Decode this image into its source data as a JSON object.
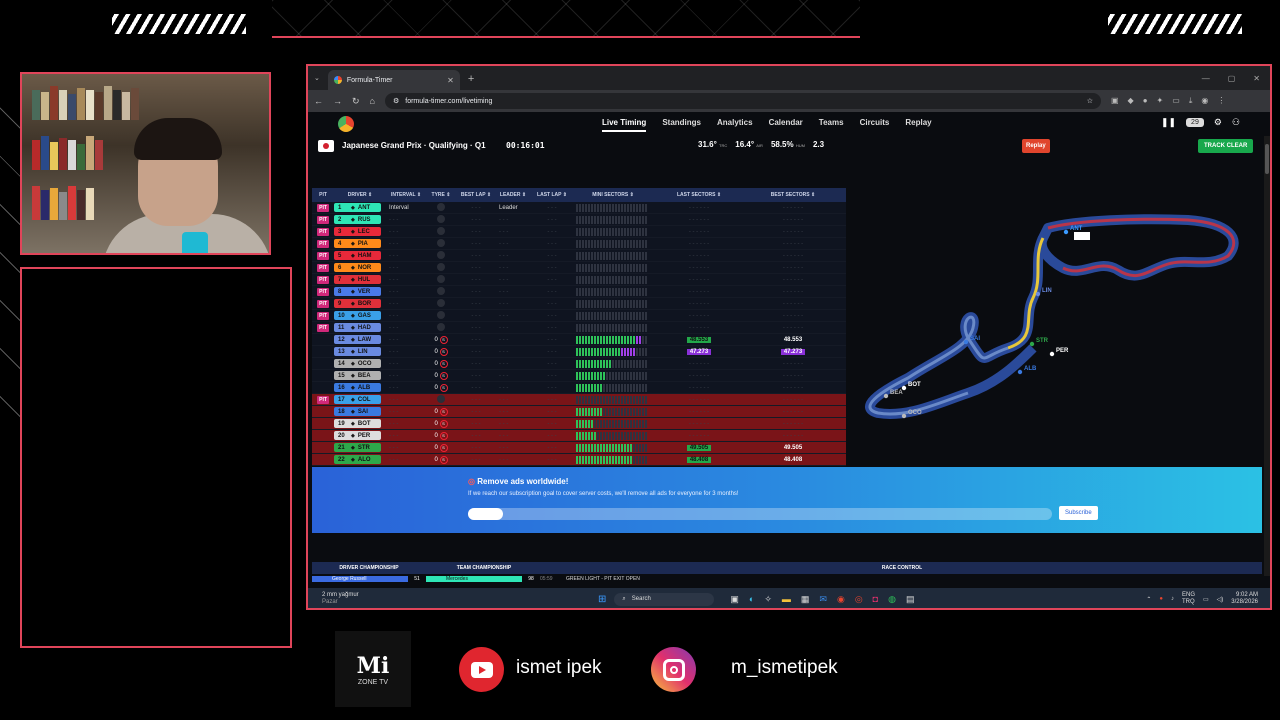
{
  "browser": {
    "tab_title": "Formula-Timer",
    "url": "formula-timer.com/livetiming"
  },
  "nav": {
    "items": [
      "Live Timing",
      "Standings",
      "Analytics",
      "Calendar",
      "Teams",
      "Circuits",
      "Replay"
    ],
    "active": "Live Timing",
    "badge": "29"
  },
  "session": {
    "title": "Japanese Grand Prix · Qualifying · Q1",
    "clock": "00:16:01",
    "track_temp": "31.6°",
    "track_temp_label": "TRC",
    "air_temp": "16.4°",
    "air_temp_label": "AIR",
    "humidity": "58.5%",
    "humidity_label": "HUM",
    "wind": "2.3",
    "replay_label": "Replay",
    "status_label": "TRACK CLEAR",
    "status_color": "#18a84c"
  },
  "table": {
    "headers": [
      "PIT",
      "DRIVER",
      "INTERVAL",
      "TYRE",
      "BEST LAP",
      "LEADER",
      "LAST LAP",
      "MINI SECTORS",
      "LAST SECTORS",
      "BEST SECTORS"
    ],
    "pit_label": "PIT",
    "rows": [
      {
        "pos": "1",
        "code": "ANT",
        "color": "#2ee6b6",
        "pit": true,
        "interval": "Interval",
        "leader": "Leader"
      },
      {
        "pos": "2",
        "code": "RUS",
        "color": "#2ee6b6",
        "pit": true
      },
      {
        "pos": "3",
        "code": "LEC",
        "color": "#e8293a",
        "pit": true
      },
      {
        "pos": "4",
        "code": "PIA",
        "color": "#ff8a1a",
        "pit": true
      },
      {
        "pos": "5",
        "code": "HAM",
        "color": "#e8293a",
        "pit": true
      },
      {
        "pos": "6",
        "code": "NOR",
        "color": "#ff8a1a",
        "pit": true
      },
      {
        "pos": "7",
        "code": "HUL",
        "color": "#e0303a",
        "pit": true
      },
      {
        "pos": "8",
        "code": "VER",
        "color": "#4a7ae8",
        "pit": true
      },
      {
        "pos": "9",
        "code": "BOR",
        "color": "#e0303a",
        "pit": true
      },
      {
        "pos": "10",
        "code": "GAS",
        "color": "#3aa0e8",
        "pit": true
      },
      {
        "pos": "11",
        "code": "HAD",
        "color": "#6a8ae0",
        "pit": true
      },
      {
        "pos": "12",
        "code": "LAW",
        "color": "#6a8ae0",
        "tyre": "0",
        "last_sector": "48.553",
        "best_sector": "48.553",
        "sector_color": "g"
      },
      {
        "pos": "13",
        "code": "LIN",
        "color": "#6a8ae0",
        "tyre": "0",
        "last_sector": "47.273",
        "best_sector": "47.273",
        "sector_color": "p"
      },
      {
        "pos": "14",
        "code": "OCO",
        "color": "#b0b0b0",
        "tyre": "0"
      },
      {
        "pos": "15",
        "code": "BEA",
        "color": "#b0b0b0",
        "tyre": "0"
      },
      {
        "pos": "16",
        "code": "ALB",
        "color": "#3a7ae0",
        "tyre": "0"
      },
      {
        "pos": "17",
        "code": "COL",
        "color": "#3aa0e8",
        "pit": true,
        "red": true
      },
      {
        "pos": "18",
        "code": "SAI",
        "color": "#3a7ae0",
        "tyre": "0",
        "red": true
      },
      {
        "pos": "19",
        "code": "BOT",
        "color": "#dddddd",
        "tyre": "0",
        "red": true
      },
      {
        "pos": "20",
        "code": "PER",
        "color": "#dddddd",
        "tyre": "0",
        "red": true
      },
      {
        "pos": "21",
        "code": "STR",
        "color": "#2ea84a",
        "tyre": "0",
        "red": true,
        "last_sector": "49.505",
        "best_sector": "49.505",
        "sector_color": "g"
      },
      {
        "pos": "22",
        "code": "ALO",
        "color": "#2ea84a",
        "tyre": "0",
        "red": true,
        "last_sector": "48.408",
        "best_sector": "48.408",
        "sector_color": "g"
      }
    ]
  },
  "map_labels": [
    "ANT",
    "LIN",
    "SAI",
    "STR",
    "ALB",
    "PER",
    "BOT",
    "BEA",
    "OCO"
  ],
  "ad": {
    "title": "Remove ads worldwide!",
    "text": "If we reach our subscription goal to cover server costs, we'll remove all ads for everyone for 3 months!",
    "progress": 0.06,
    "button": "Subscribe"
  },
  "championship": {
    "driver_header": "DRIVER CHAMPIONSHIP",
    "team_header": "TEAM CHAMPIONSHIP",
    "race_control_header": "RACE CONTROL",
    "driver_first": "George Russell",
    "driver_points": "51",
    "team_first": "Mercedes",
    "team_points": "98",
    "rc_time": "05:59",
    "rc_message": "GREEN LIGHT - PIT EXIT OPEN"
  },
  "taskbar": {
    "weather": "2 mm yağmur",
    "weather_sub": "Pazar",
    "search": "Search",
    "lang": "ENG",
    "lang_sub": "TRQ",
    "time": "9:02 AM",
    "date": "3/28/2026"
  },
  "branding": {
    "logo_big": "Mi",
    "logo_small": "ZONE TV",
    "youtube": "ismet ipek",
    "instagram": "m_ismetipek"
  }
}
